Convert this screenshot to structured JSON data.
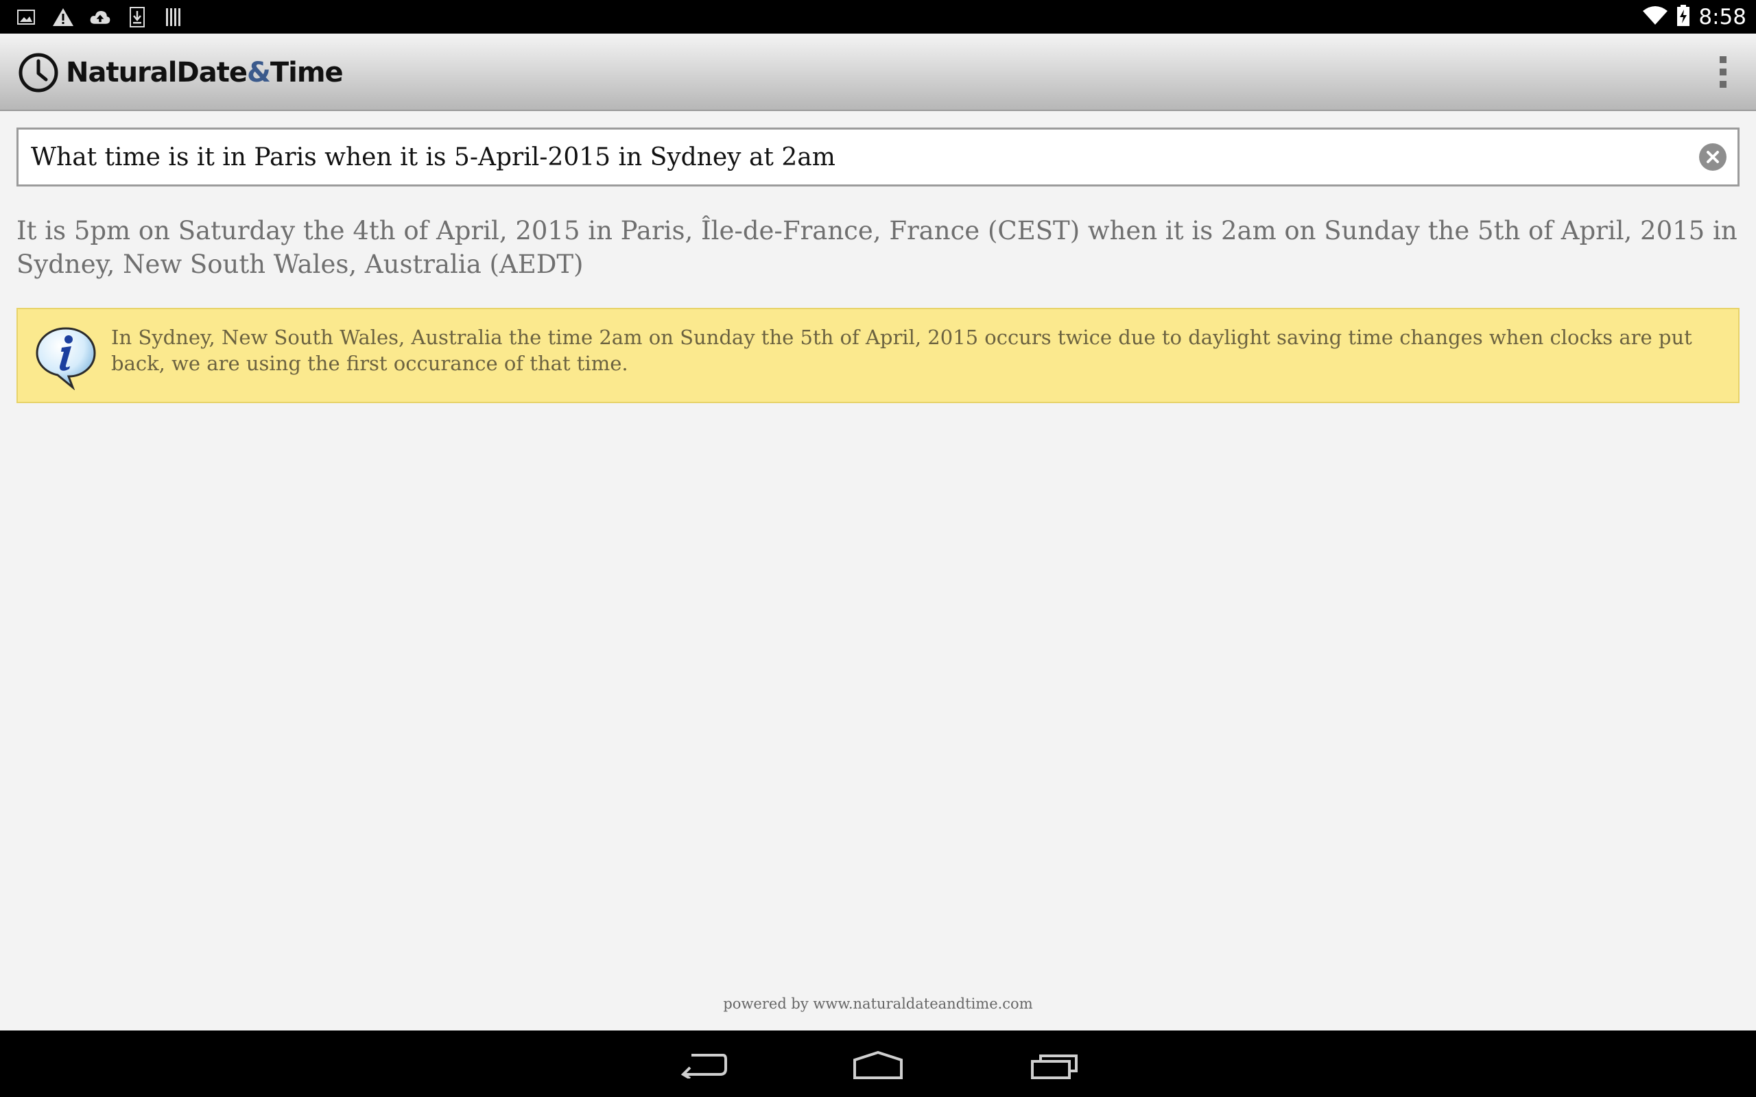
{
  "status_bar": {
    "time": "8:58",
    "left_icons": [
      "image-icon",
      "warning-icon",
      "cloud-upload-icon",
      "download-icon",
      "barcode-icon"
    ],
    "right_icons": [
      "wifi-icon",
      "battery-charging-icon"
    ]
  },
  "app_bar": {
    "title_part1": "NaturalDate",
    "title_amp": "&",
    "title_part2": "Time",
    "logo_icon": "clock-icon",
    "menu_icon": "overflow-menu-icon",
    "amp_color": "#3b5a8c"
  },
  "query": {
    "value": "What time is it in Paris when it is 5-April-2015 in Sydney at 2am",
    "clear_icon": "clear-icon"
  },
  "result": {
    "text": "It is 5pm on Saturday the 4th of April, 2015 in Paris, Île-de-France, France (CEST) when it is 2am on Sunday the 5th of April, 2015 in Sydney, New South Wales, Australia (AEDT)"
  },
  "info": {
    "icon": "info-speech-bubble-icon",
    "text": "In Sydney, New South Wales, Australia the time 2am on Sunday the 5th of April, 2015 occurs twice due to daylight saving time changes when clocks are put back, we are using the first occurance of that time.",
    "background_color": "#fbe98e"
  },
  "footer": {
    "powered_by": "powered by www.naturaldateandtime.com"
  },
  "nav_bar": {
    "back_icon": "back-icon",
    "home_icon": "home-icon",
    "recents_icon": "recent-apps-icon"
  }
}
